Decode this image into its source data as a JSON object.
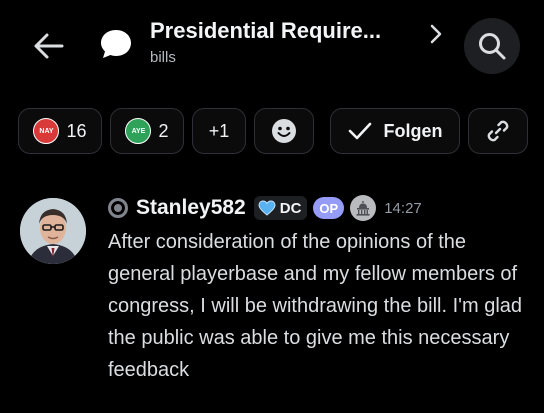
{
  "header": {
    "title": "Presidential Require...",
    "subtitle": "bills"
  },
  "actions": {
    "nay": {
      "label": "NAY",
      "count": "16",
      "color": "#d83a3a"
    },
    "aye": {
      "label": "AYE",
      "count": "2",
      "color": "#2fa25a"
    },
    "more_reactions": "+1",
    "follow_label": "Folgen"
  },
  "message": {
    "username": "Stanley582",
    "tag": "DC",
    "op_badge": "OP",
    "timestamp": "14:27",
    "body": "After consideration of the opinions of the general playerbase and my fellow members of congress, I will be withdrawing the bill. I'm glad the public was able to give me this necessary feedback"
  },
  "colors": {
    "background": "#000000",
    "pill_border": "#2e3035",
    "op_badge": "#949cf7",
    "search_bg": "#1e1f22"
  }
}
